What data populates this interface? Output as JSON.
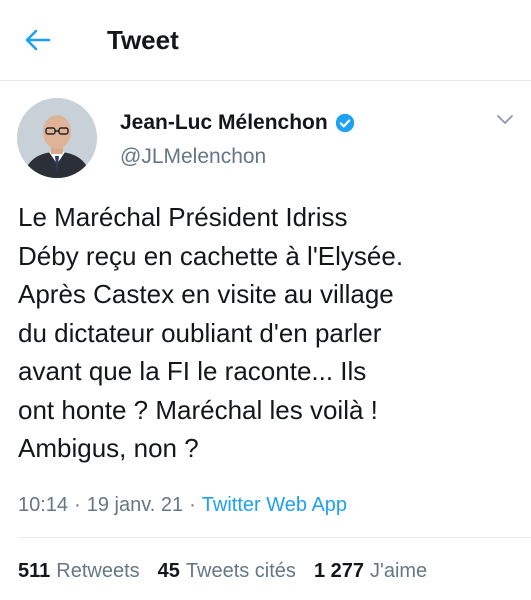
{
  "header": {
    "title": "Tweet",
    "back_icon": "arrow-left-icon"
  },
  "colors": {
    "accent": "#1da1f2",
    "text": "#14171a",
    "muted": "#657786",
    "divider": "#e6ecf0"
  },
  "author": {
    "name": "Jean-Luc Mélenchon",
    "handle": "@JLMelenchon",
    "verified": true,
    "verified_icon": "verified-badge-icon"
  },
  "tweet": {
    "lines": [
      "Le Maréchal Président Idriss",
      "Déby reçu en cachette à l'Elysée.",
      "Après Castex en visite au village",
      "du dictateur oubliant d'en parler",
      "avant que la FI le raconte... Ils",
      "ont honte ? Maréchal les voilà !",
      "Ambigus, non ?"
    ],
    "time": "10:14",
    "date": "19 janv. 21",
    "separator": "·",
    "source": "Twitter Web App"
  },
  "stats": {
    "retweets_count": "511",
    "retweets_label": "Retweets",
    "quotes_count": "45",
    "quotes_label": "Tweets cités",
    "likes_count": "1 277",
    "likes_label": "J'aime"
  }
}
